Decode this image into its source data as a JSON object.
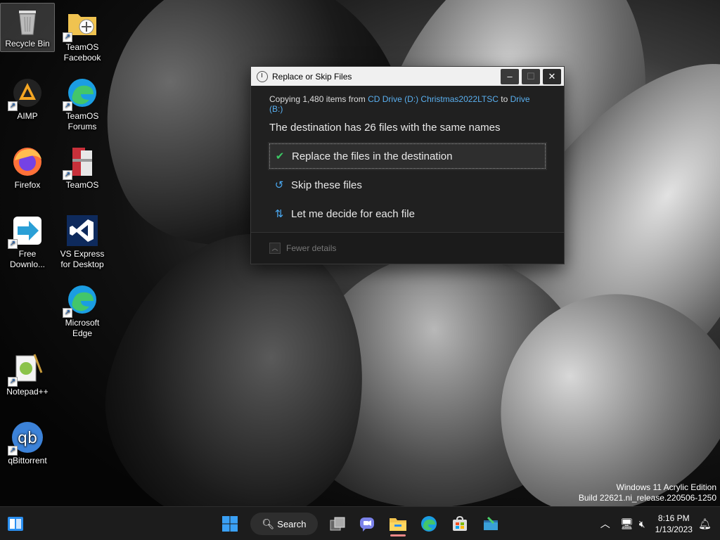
{
  "desktop": {
    "icons": [
      {
        "label": "Recycle Bin"
      },
      {
        "label": "TeamOS Facebook"
      },
      {
        "label": "AIMP"
      },
      {
        "label": "TeamOS Forums"
      },
      {
        "label": "Firefox"
      },
      {
        "label": "TeamOS"
      },
      {
        "label": "Free Downlo..."
      },
      {
        "label": "VS Express for Desktop"
      },
      {
        "label": "Microsoft Edge"
      },
      {
        "label": "Notepad++"
      },
      {
        "label": "qBittorrent"
      }
    ]
  },
  "dialog": {
    "title": "Replace or Skip Files",
    "copy_prefix": "Copying 1,480 items from",
    "copy_source": "CD Drive (D:) Christmas2022LTSC",
    "copy_to": "to",
    "copy_dest": "Drive (B:)",
    "heading": "The destination has 26 files with the same names",
    "options": [
      {
        "label": "Replace the files in the destination",
        "icon": "check-icon"
      },
      {
        "label": "Skip these files",
        "icon": "skip-arrow-icon"
      },
      {
        "label": "Let me decide for each file",
        "icon": "compare-icon"
      }
    ],
    "footer_label": "Fewer details"
  },
  "watermark": {
    "line1": "Windows 11 Acrylic Edition",
    "line2": "Build 22621.ni_release.220506-1250"
  },
  "taskbar": {
    "search_label": "Search",
    "time": "8:16 PM",
    "date": "1/13/2023"
  },
  "colors": {
    "link": "#5ab0f0",
    "accent": "#0078d4",
    "dialog_bg": "#202020"
  }
}
